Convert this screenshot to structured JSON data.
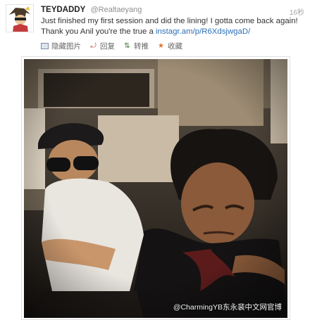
{
  "tweet": {
    "display_name": "TEYDADDY",
    "handle": "@Realtaeyang",
    "time": "16秒",
    "text_plain": "Just finished my first session and did the lining! I gotta come back again! Thank you Anil you're the true a",
    "link": "instagr.am/p/R6XdsjwgaD/"
  },
  "actions": [
    {
      "label": "隐藏图片",
      "icon": "photo-icon"
    },
    {
      "label": "回复",
      "icon": "reply-icon"
    },
    {
      "label": "转推",
      "icon": "retweet-icon"
    },
    {
      "label": "收藏",
      "icon": "favorite-icon"
    }
  ],
  "photo": {
    "watermark": "@CharmingYB东永裴中文网官博"
  },
  "colors": {
    "link": "#2b6fb6",
    "reply_icon": "#c53b3b",
    "retweet_icon": "#3f7a2f",
    "favorite_icon": "#e0782d"
  }
}
